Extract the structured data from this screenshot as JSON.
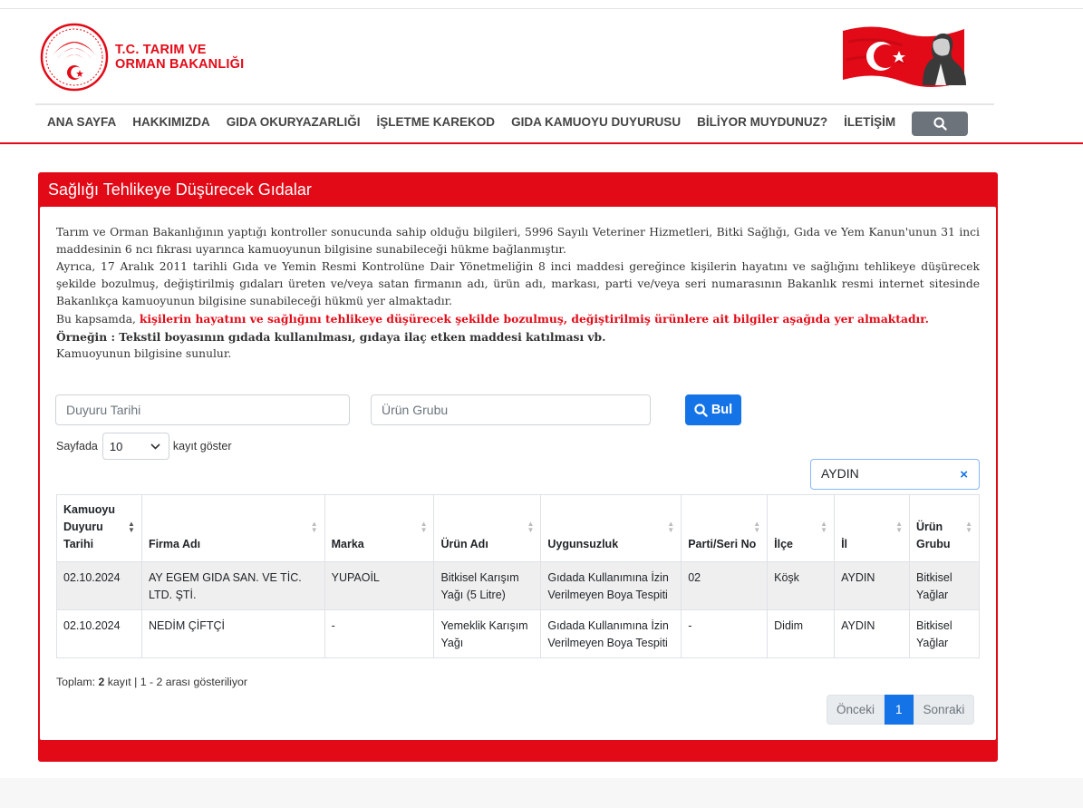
{
  "header": {
    "logo_line1": "T.C. TARIM VE",
    "logo_line2": "ORMAN BAKANLIĞI",
    "search_icon": "search-icon"
  },
  "nav": {
    "items": [
      "ANA SAYFA",
      "HAKKIMIZDA",
      "GIDA OKURYAZARLIĞI",
      "İŞLETME KAREKOD",
      "GIDA KAMUOYU DUYURUSU",
      "BİLİYOR MUYDUNUZ?",
      "İLETİŞİM"
    ]
  },
  "panel": {
    "title": "Sağlığı Tehlikeye Düşürecek Gıdalar",
    "intro1": "Tarım ve Orman Bakanlığının yaptığı kontroller sonucunda sahip olduğu bilgileri, 5996 Sayılı Veteriner Hizmetleri, Bitki Sağlığı, Gıda ve Yem Kanun'unun 31 inci maddesinin 6 ncı fıkrası uyarınca kamuoyunun bilgisine sunabileceği hükme bağlanmıştır.",
    "intro2": "Ayrıca, 17 Aralık 2011 tarihli Gıda ve Yemin Resmi Kontrolüne Dair Yönetmeliğin 8 inci maddesi gereğince kişilerin hayatını ve sağlığını tehlikeye düşürecek şekilde bozulmuş, değiştirilmiş gıdaları üreten ve/veya satan firmanın adı, ürün adı, markası, parti ve/veya seri numarasının Bakanlık resmi internet sitesinde Bakanlıkça kamuoyunun bilgisine sunabileceği hükmü yer almaktadır.",
    "intro3_prefix": "Bu kapsamda, ",
    "intro3_red": "kişilerin hayatını ve sağlığını tehlikeye düşürecek şekilde bozulmuş, değiştirilmiş ürünlere ait bilgiler aşağıda yer almaktadır.",
    "intro4": "Örneğin : Tekstil boyasının gıdada kullanılması, gıdaya ilaç etken maddesi katılması vb.",
    "intro5": "Kamuoyunun bilgisine sunulur."
  },
  "search": {
    "date_placeholder": "Duyuru Tarihi",
    "group_placeholder": "Ürün Grubu",
    "find_label": "Bul",
    "length_prefix": "Sayfada",
    "length_value": "10",
    "length_suffix": "kayıt göster",
    "filter_value": "AYDIN",
    "clear_glyph": "×"
  },
  "table": {
    "headers": {
      "date": "Kamuoyu Duyuru Tarihi",
      "firm": "Firma Adı",
      "brand": "Marka",
      "product": "Ürün Adı",
      "issue": "Uygunsuzluk",
      "lot": "Parti/Seri No",
      "district": "İlçe",
      "city": "İl",
      "group": "Ürün Grubu"
    },
    "rows": [
      {
        "date": "02.10.2024",
        "firm": "AY EGEM GIDA SAN. VE TİC. LTD. ŞTİ.",
        "brand": "YUPAOİL",
        "product": "Bitkisel Karışım Yağı (5 Litre)",
        "issue": "Gıdada Kullanımına İzin Verilmeyen Boya Tespiti",
        "lot": "02",
        "district": "Köşk",
        "city": "AYDIN",
        "group": "Bitkisel Yağlar"
      },
      {
        "date": "02.10.2024",
        "firm": "NEDİM ÇİFTÇİ",
        "brand": "-",
        "product": "Yemeklik Karışım Yağı",
        "issue": "Gıdada Kullanımına İzin Verilmeyen Boya Tespiti",
        "lot": "-",
        "district": "Didim",
        "city": "AYDIN",
        "group": "Bitkisel Yağlar"
      }
    ]
  },
  "footer_info": {
    "prefix": "Toplam: ",
    "count": "2",
    "suffix": " kayıt | 1 - 2 arası gösteriliyor"
  },
  "pagination": {
    "prev": "Önceki",
    "current": "1",
    "next": "Sonraki"
  },
  "colors": {
    "brand_red": "#e30a17",
    "primary_blue": "#1473e6"
  }
}
